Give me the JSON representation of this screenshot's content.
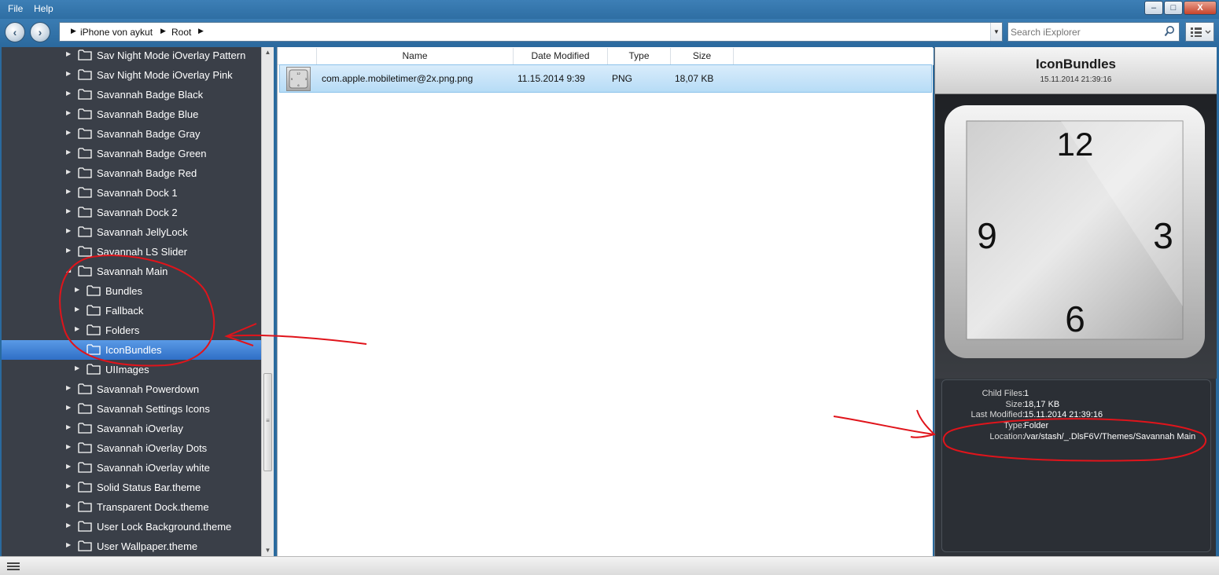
{
  "menu": {
    "file": "File",
    "help": "Help"
  },
  "window_controls": {
    "minimize": "–",
    "maximize": "□",
    "close": "X"
  },
  "nav": {
    "back": "‹",
    "forward": "›"
  },
  "breadcrumb": {
    "items": [
      "iPhone von aykut",
      "Root"
    ]
  },
  "search": {
    "placeholder": "Search iExplorer"
  },
  "tree": {
    "items": [
      {
        "label": "Sav Night Mode iOverlay Pattern",
        "level": 0,
        "expanded": false
      },
      {
        "label": "Sav Night Mode iOverlay Pink",
        "level": 0,
        "expanded": false
      },
      {
        "label": "Savannah Badge Black",
        "level": 0,
        "expanded": false
      },
      {
        "label": "Savannah Badge Blue",
        "level": 0,
        "expanded": false
      },
      {
        "label": "Savannah Badge Gray",
        "level": 0,
        "expanded": false
      },
      {
        "label": "Savannah Badge Green",
        "level": 0,
        "expanded": false
      },
      {
        "label": "Savannah Badge Red",
        "level": 0,
        "expanded": false
      },
      {
        "label": "Savannah Dock 1",
        "level": 0,
        "expanded": false
      },
      {
        "label": "Savannah Dock 2",
        "level": 0,
        "expanded": false
      },
      {
        "label": "Savannah JellyLock",
        "level": 0,
        "expanded": false
      },
      {
        "label": "Savannah LS Slider",
        "level": 0,
        "expanded": false
      },
      {
        "label": "Savannah Main",
        "level": 0,
        "expanded": true
      },
      {
        "label": "Bundles",
        "level": 1,
        "expanded": false
      },
      {
        "label": "Fallback",
        "level": 1,
        "expanded": false
      },
      {
        "label": "Folders",
        "level": 1,
        "expanded": false
      },
      {
        "label": "IconBundles",
        "level": 1,
        "selected": true,
        "leaf": true
      },
      {
        "label": "UIImages",
        "level": 1,
        "expanded": false
      },
      {
        "label": "Savannah Powerdown",
        "level": 0,
        "expanded": false
      },
      {
        "label": "Savannah Settings Icons",
        "level": 0,
        "expanded": false
      },
      {
        "label": "Savannah iOverlay",
        "level": 0,
        "expanded": false
      },
      {
        "label": "Savannah iOverlay Dots",
        "level": 0,
        "expanded": false
      },
      {
        "label": "Savannah iOverlay white",
        "level": 0,
        "expanded": false
      },
      {
        "label": "Solid Status Bar.theme",
        "level": 0,
        "expanded": false
      },
      {
        "label": "Transparent Dock.theme",
        "level": 0,
        "expanded": false
      },
      {
        "label": "User Lock Background.theme",
        "level": 0,
        "expanded": false
      },
      {
        "label": "User Wallpaper.theme",
        "level": 0,
        "expanded": false
      }
    ]
  },
  "file_list": {
    "columns": [
      "Name",
      "Date Modified",
      "Type",
      "Size"
    ],
    "rows": [
      {
        "name": "com.apple.mobiletimer@2x.png.png",
        "date": "11.15.2014 9:39",
        "type": "PNG",
        "size": "18,07 KB"
      }
    ]
  },
  "preview": {
    "title": "IconBundles",
    "date": "15.11.2014 21:39:16",
    "clock_numbers": [
      "12",
      "3",
      "6",
      "9"
    ],
    "info": [
      {
        "label": "Child Files:",
        "value": "1"
      },
      {
        "label": "Size:",
        "value": "18,17 KB"
      },
      {
        "label": "Last Modified:",
        "value": "15.11.2014 21:39:16"
      },
      {
        "label": "Type:",
        "value": "Folder"
      },
      {
        "label": "Location:",
        "value": "/var/stash/_.DlsF6V/Themes/Savannah Main"
      }
    ]
  },
  "colors": {
    "selection": "#3c7fd8",
    "sidebar_bg": "#3a3f48",
    "annotation": "#e0141b"
  }
}
